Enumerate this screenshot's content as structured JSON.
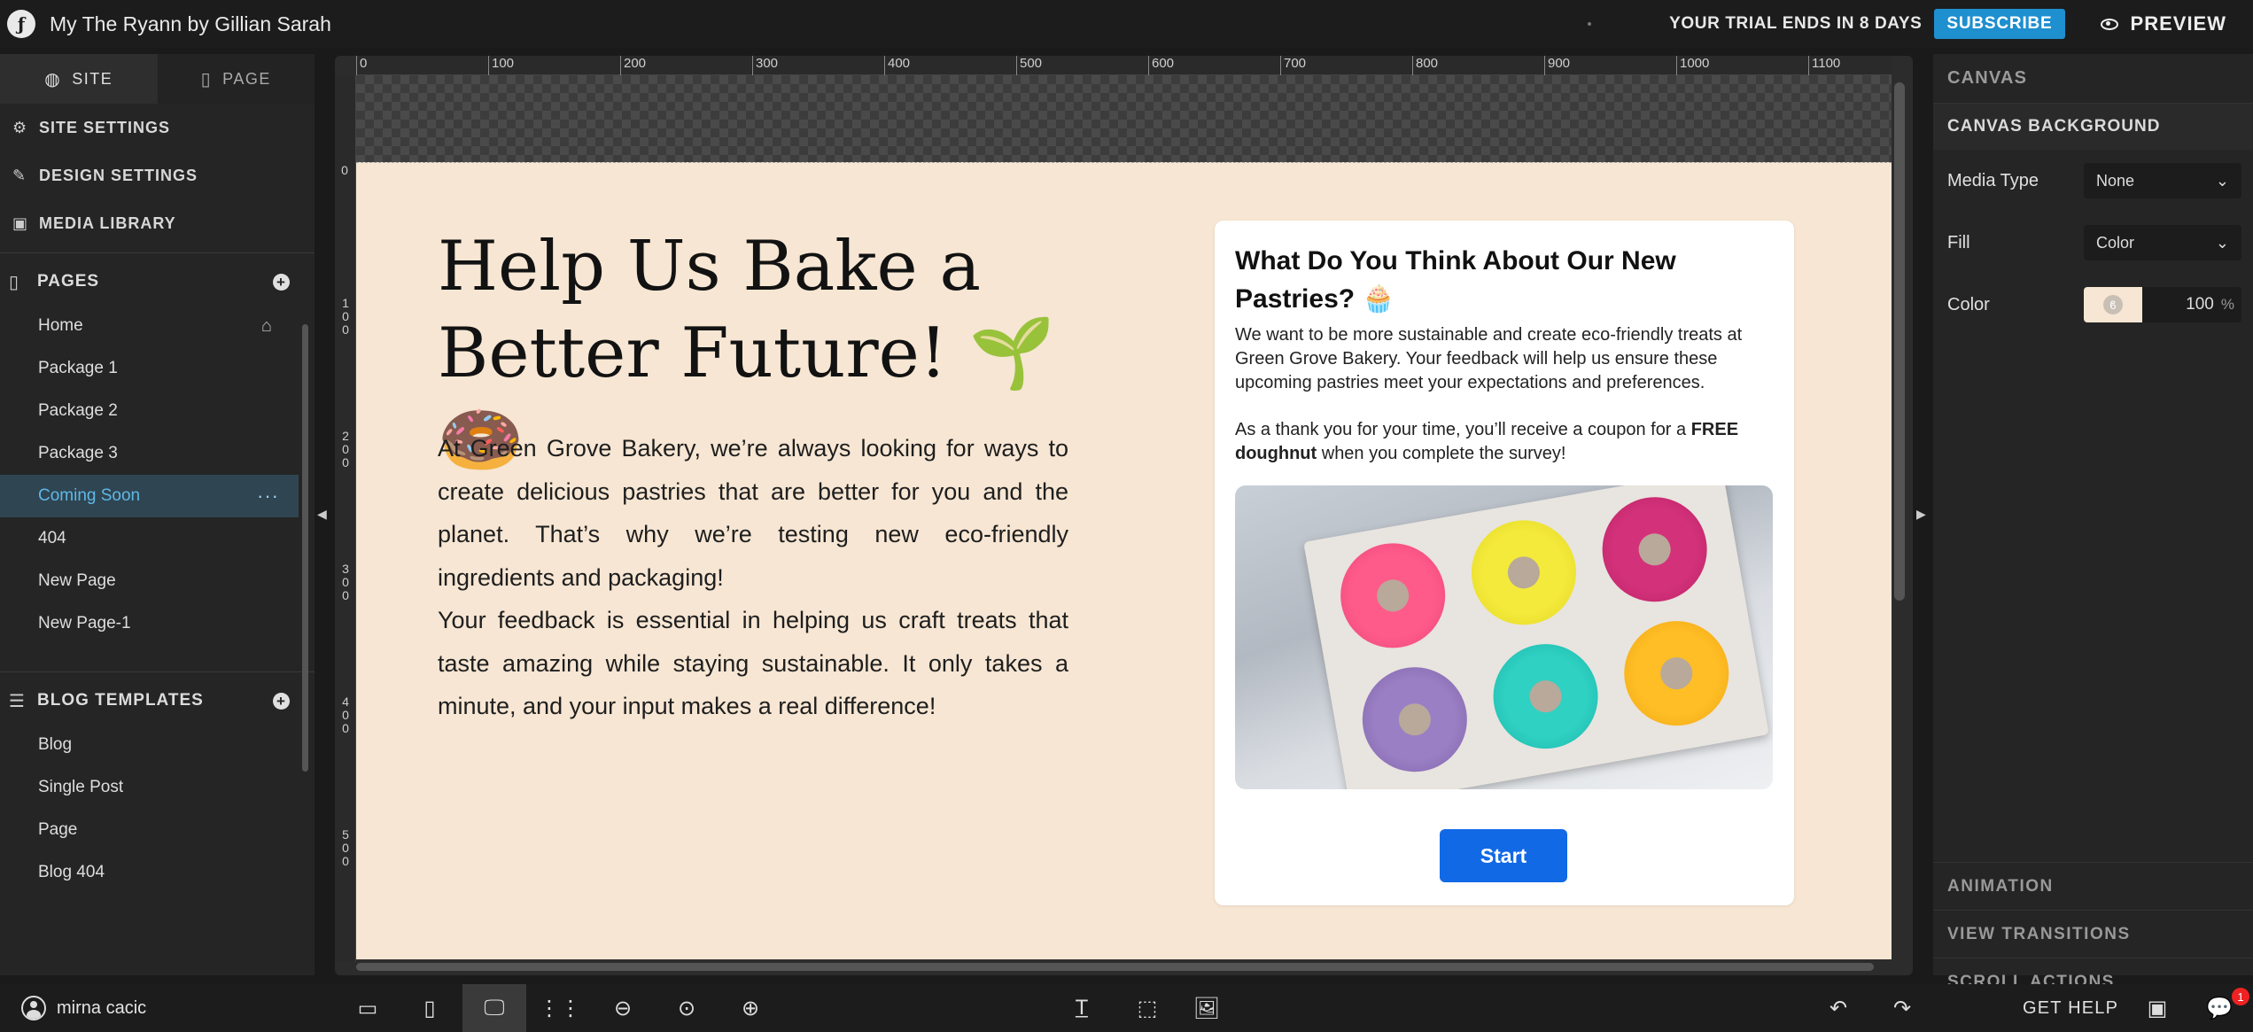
{
  "app": {
    "site_title": "My The Ryann by Gillian Sarah",
    "trial_text": "YOUR TRIAL ENDS IN 8 DAYS",
    "subscribe_label": "SUBSCRIBE",
    "preview_label": "PREVIEW"
  },
  "sidebar": {
    "tabs": [
      {
        "label": "SITE",
        "icon": "globe-icon"
      },
      {
        "label": "PAGE",
        "icon": "page-icon"
      }
    ],
    "links": [
      {
        "label": "SITE SETTINGS",
        "icon": "gear-icon"
      },
      {
        "label": "DESIGN SETTINGS",
        "icon": "pencil-icon"
      },
      {
        "label": "MEDIA LIBRARY",
        "icon": "image-icon"
      }
    ],
    "pages_header": "PAGES",
    "pages": [
      "Home",
      "Package 1",
      "Package 2",
      "Package 3",
      "Coming Soon",
      "404",
      "New Page",
      "New Page-1"
    ],
    "active_page": "Coming Soon",
    "blog_header": "BLOG TEMPLATES",
    "blog_templates": [
      "Blog",
      "Single Post",
      "Page",
      "Blog 404"
    ]
  },
  "ruler": {
    "top": [
      "0",
      "100",
      "200",
      "300",
      "400",
      "500",
      "600",
      "700",
      "800",
      "900",
      "1000",
      "1100"
    ],
    "left": [
      "0",
      "100",
      "200",
      "300",
      "400",
      "500"
    ]
  },
  "canvas": {
    "hero_title": "Help Us Bake a Better Future! 🌱 🍩",
    "hero_p1": "At Green Grove Bakery, we’re always looking for ways to create delicious pastries that are better for you and the planet. That’s why we’re testing new eco-friendly ingredients and packaging!",
    "hero_p2": "Your feedback is essential in helping us craft treats that taste amazing while staying sustainable. It only takes a minute, and your input makes a real difference!",
    "card_title": "What Do You Think About Our New Pastries? 🧁",
    "card_p1": "We want to be more sustainable and create eco-friendly treats at Green Grove Bakery. Your feedback will help us ensure these upcoming pastries meet your expectations and preferences.",
    "card_p2_a": "As a thank you for your time, you’ll receive a coupon for a ",
    "card_p2_b": "FREE doughnut",
    "card_p2_c": " when you complete the survey!",
    "start_label": "Start",
    "background_color": "#f6e6d3",
    "button_color": "#1169e6"
  },
  "rpanel": {
    "canvas_header": "CANVAS",
    "bg_header": "CANVAS BACKGROUND",
    "media_type_label": "Media Type",
    "media_type_value": "None",
    "fill_label": "Fill",
    "fill_value": "Color",
    "color_label": "Color",
    "opacity_value": "100",
    "opacity_unit": "%",
    "bottom_sections": [
      "ANIMATION",
      "VIEW TRANSITIONS",
      "SCROLL ACTIONS"
    ]
  },
  "bottombar": {
    "user_name": "mirna cacic",
    "get_help": "GET HELP",
    "notification_count": "1"
  }
}
